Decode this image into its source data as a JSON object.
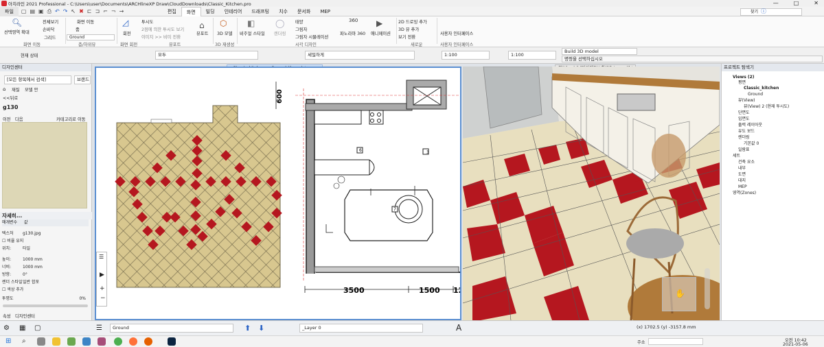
{
  "app": {
    "title": "아치라인 2021  Professional - C:\\Users\\user\\Documents\\ARCHlineXP Draw\\CloudDownloads\\Classic_Kitchen.pro",
    "window_controls": [
      "—",
      "□",
      "✕"
    ]
  },
  "ribbon_tabs": [
    "파일",
    "편집",
    "화면",
    "빌딩",
    "인테리어",
    "드래프팅",
    "치수",
    "문서화",
    "MEP"
  ],
  "active_tab": "화면",
  "search": {
    "placeholder": "찾기"
  },
  "ribbon": {
    "fit_button": "선택영역 확대",
    "whole_view": "전체보기",
    "zoom_tool": "손바닥",
    "zoom_label": "줌",
    "grid": "그리드",
    "screen_move": "화면 이동",
    "ground": "Ground",
    "screen_move_group": "화면 이동",
    "floor_group": "층/하위뷰",
    "rotate": "회전",
    "rotate_group": "화면 회전",
    "perspective": "투시도",
    "two_point_perspective": "2점에 의한 투시도 보기",
    "previous_view": "이미지 >> 비미 전환",
    "viewport": "뷰포트",
    "viewport_group": "뷰포트",
    "model_3d": "3D 모델",
    "model_3d_group": "3D 재생성",
    "visual_style": "비주얼 스타일",
    "render": "렌더링",
    "sun": "태양",
    "shadow": "그림자",
    "shadow_sim": "그림자 시뮬레이션",
    "visual_group": "시각 디자인",
    "panorama": "파노라마 360",
    "animation": "애니메이션",
    "drawing_add": "2D 드로잉 추가",
    "model_add": "3D 뷰 추가",
    "view_switch": "보기 전환",
    "new_view_group": "새로운",
    "ui": "사용자 인터페이스",
    "ui_group": "사용자 인터페이스"
  },
  "propbar": {
    "current_state": "현재 상태",
    "all": "모두",
    "fine": "세밀하게",
    "scale1": "1:100",
    "scale2": "1:100",
    "build_model": "Build 3D model",
    "prompt": "명령을 선택하십시오"
  },
  "left_panel": {
    "title": "디자인센터",
    "search_placeholder": "[모든 항목에서 검색]",
    "brand": "브랜드",
    "tabs": [
      "재질",
      "모델 안"
    ],
    "back": "<<뒤로",
    "item_name": "g130",
    "nav_prev": "이전",
    "nav_next": "다음",
    "category": "카테고리로 이동",
    "details_title": "자세히...",
    "param": "매개변수",
    "value": "값",
    "texture_label": "텍스처",
    "texture_value": "g130.jpg",
    "ratio_label": "비율 유지",
    "position_label": "위치:",
    "position_value": "타일",
    "height_label": "높이:",
    "height_value": "1000 mm",
    "width_label": "너비:",
    "width_value": "1000 mm",
    "direction_label": "방향:",
    "direction_value": "0°",
    "render_style_label": "렌더 스타일",
    "render_style_value": "일반 합포",
    "color_add": "색상 추가",
    "transparency": "투명도",
    "transparency_value": "0%",
    "footer_tabs": [
      "속성",
      "디자인센터"
    ]
  },
  "plan_view": {
    "tab_title": "Classic_kitchen - - Ground (0 mm) *",
    "dim_left": "600",
    "dim_1": "3500",
    "dim_2": "1500",
    "dim_3": "12",
    "tag_a": "3",
    "tag_b": "6",
    "tag_c": "7"
  },
  "view3d": {
    "tab_title": "뷰(View) 2 [다이렉트X 창(3D Image)] *"
  },
  "right_panel": {
    "title": "프로젝트 탐색기",
    "items": [
      "Views (2)",
      "평면",
      "Classic_kitchen",
      "Ground",
      "뷰(View)",
      "뷰(View) 2 (현재 투시도)",
      "단면도",
      "입면도",
      "출력 레이아웃",
      "유도 보드",
      "렌더링",
      "기본값 0",
      "일람표",
      "세트",
      "건축 요소",
      "내부",
      "도면",
      "대지",
      "MEP",
      "영역(Zones)"
    ]
  },
  "bottombar": {
    "floor": "Ground",
    "layer": "_Layer 0",
    "coords": "(x) 1702.5  (y) -3157.8 mm"
  },
  "taskbar": {
    "address_label": "주소",
    "time": "오전 10:42",
    "date": "2021-05-06"
  },
  "colors": {
    "tile_red": "#b5171f",
    "tile_cream": "#e8dfbf",
    "plan_tile_tan": "#d8c78f",
    "accent_blue": "#5b8fd1"
  }
}
